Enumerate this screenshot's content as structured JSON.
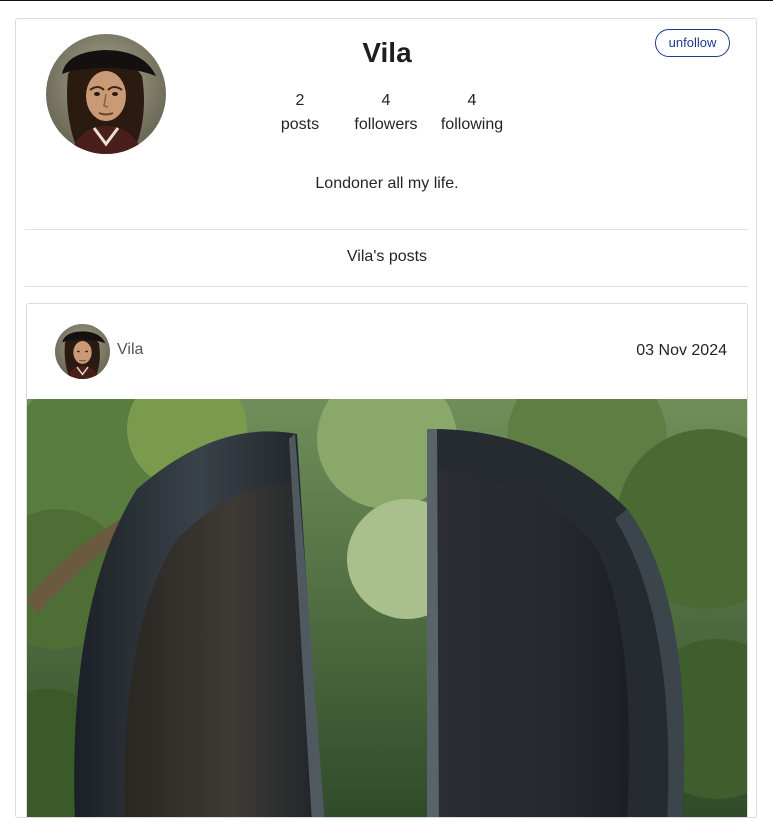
{
  "profile": {
    "username": "Vila",
    "unfollow_label": "unfollow",
    "bio": "Londoner all my life.",
    "stats": [
      {
        "value": "2",
        "label": "posts"
      },
      {
        "value": "4",
        "label": "followers"
      },
      {
        "value": "4",
        "label": "following"
      }
    ]
  },
  "posts_section": {
    "title": "Vila's posts"
  },
  "posts": [
    {
      "author": "Vila",
      "date": "03 Nov 2024"
    }
  ],
  "colors": {
    "accent": "#1b3a8c",
    "border": "#dcdcdc"
  }
}
